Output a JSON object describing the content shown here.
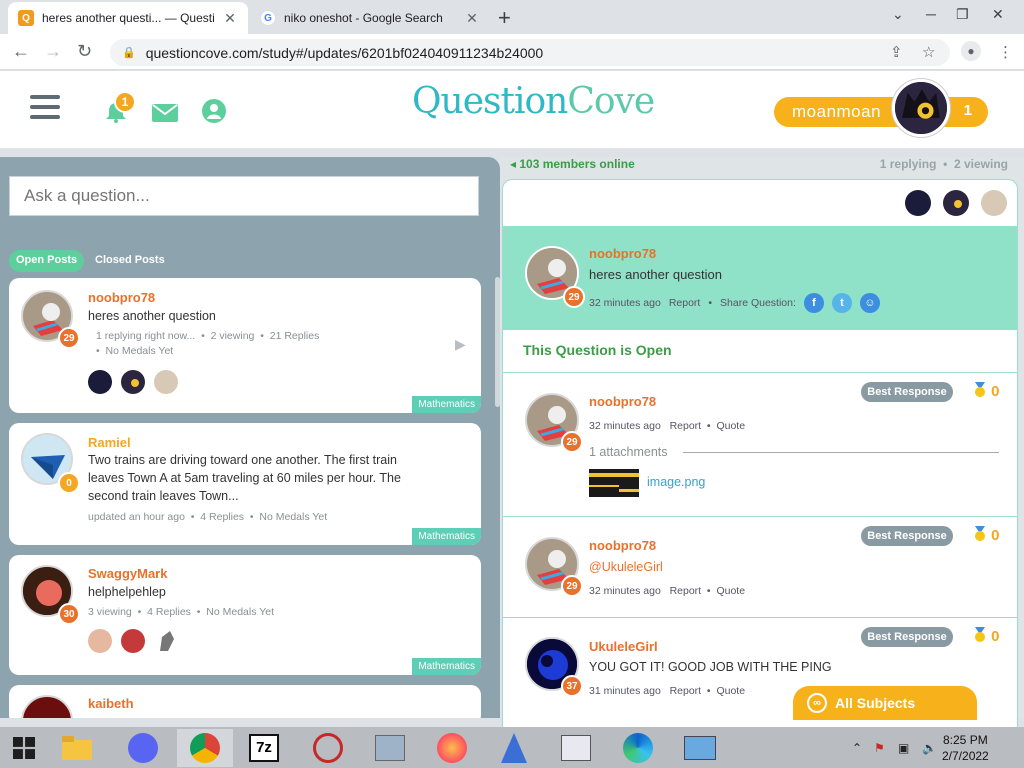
{
  "browser": {
    "tabs": [
      {
        "title": "heres another questi... — Questi",
        "active": true
      },
      {
        "title": "niko oneshot - Google Search",
        "active": false
      }
    ],
    "url": "questioncove.com/study#/updates/6201bf024040911234b24000"
  },
  "header": {
    "logo_left": "Question",
    "logo_right": "Cove",
    "notification_count": "1",
    "username": "moanmoan",
    "user_count": "1"
  },
  "left": {
    "ask_placeholder": "Ask a question...",
    "tabs": {
      "open": "Open Posts",
      "closed": "Closed Posts"
    },
    "posts": [
      {
        "name": "noobpro78",
        "level": "29",
        "text": "heres another question",
        "meta1": "1 replying right now...",
        "meta2": "2 viewing",
        "meta3": "21 Replies",
        "meta4": "No Medals Yet",
        "subject": "Mathematics"
      },
      {
        "name": "Ramiel",
        "level": "0",
        "text": "Two trains are driving toward one another. The first train leaves Town A at 5am traveling at 60 miles per hour. The second train leaves Town...",
        "meta1": "updated an hour ago",
        "meta2": "4 Replies",
        "meta3": "No Medals Yet",
        "subject": "Mathematics"
      },
      {
        "name": "SwaggyMark",
        "level": "30",
        "text": "helphelpehlep",
        "meta1": "3 viewing",
        "meta2": "4 Replies",
        "meta3": "No Medals Yet",
        "subject": "Mathematics"
      },
      {
        "name": "kaibeth"
      }
    ]
  },
  "right": {
    "online": "103 members online",
    "replying": "1 replying",
    "viewing": "2 viewing",
    "question": {
      "name": "noobpro78",
      "level": "29",
      "text": "heres another question",
      "time": "32 minutes ago",
      "report": "Report",
      "share": "Share Question:"
    },
    "status": "This Question is Open",
    "replies": [
      {
        "name": "noobpro78",
        "level": "29",
        "time": "32 minutes ago",
        "report": "Report",
        "quote": "Quote",
        "attachments": "1 attachments",
        "file": "image.png",
        "best": "Best Response",
        "medals": "0"
      },
      {
        "name": "noobpro78",
        "level": "29",
        "text": "@UkuleleGirl",
        "time": "32 minutes ago",
        "report": "Report",
        "quote": "Quote",
        "best": "Best Response",
        "medals": "0"
      },
      {
        "name": "UkuleleGirl",
        "level": "37",
        "text": "YOU GOT IT! GOOD JOB WITH THE PING",
        "time": "31 minutes ago",
        "report": "Report",
        "quote": "Quote",
        "best": "Best Response",
        "medals": "0"
      }
    ],
    "all_subjects": "All Subjects"
  },
  "taskbar": {
    "time": "8:25 PM",
    "date": "2/7/2022"
  }
}
